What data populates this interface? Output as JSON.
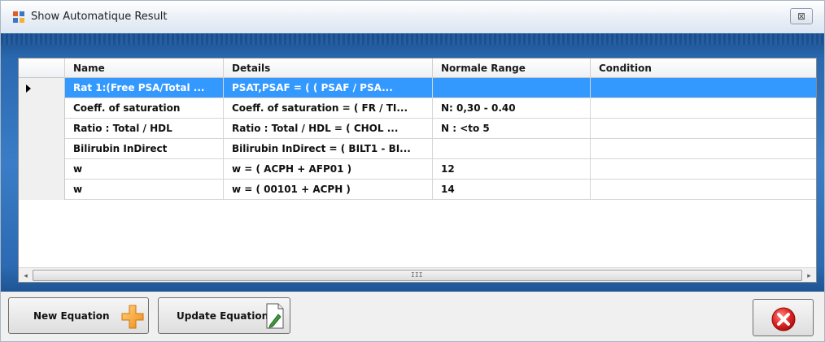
{
  "window": {
    "title": "Show Automatique Result",
    "close_glyph": "⊠",
    "icon": "app-window-icon"
  },
  "grid": {
    "columns": [
      "Name",
      "Details",
      "Normale Range",
      "Condition"
    ],
    "rows": [
      {
        "name": "Rat 1:(Free PSA/Total ...",
        "details": "PSAT,PSAF = ( ( PSAF / PSA...",
        "range": "",
        "condition": "",
        "selected": true
      },
      {
        "name": "Coeff. of saturation",
        "details": "Coeff. of saturation = ( FR / TI...",
        "range": "N: 0,30 - 0.40",
        "condition": ""
      },
      {
        "name": "Ratio : Total / HDL",
        "details": "Ratio : Total / HDL = ( CHOL ...",
        "range": "N : <to 5",
        "condition": ""
      },
      {
        "name": "Bilirubin InDirect",
        "details": "Bilirubin InDirect = ( BILT1 - BI...",
        "range": "",
        "condition": ""
      },
      {
        "name": "w",
        "details": "w = ( ACPH + AFP01 )",
        "range": "12",
        "condition": ""
      },
      {
        "name": "w",
        "details": "w = ( 00101 + ACPH )",
        "range": "14",
        "condition": ""
      }
    ],
    "scrollbar": {
      "left_arrow": "◂",
      "right_arrow": "▸",
      "grip": "III"
    }
  },
  "buttons": {
    "new_equation": "New Equation",
    "update_equation": "Update Equation"
  },
  "colors": {
    "selection": "#3399ff",
    "band": "#2a69b0",
    "exit_red": "#e02020"
  }
}
